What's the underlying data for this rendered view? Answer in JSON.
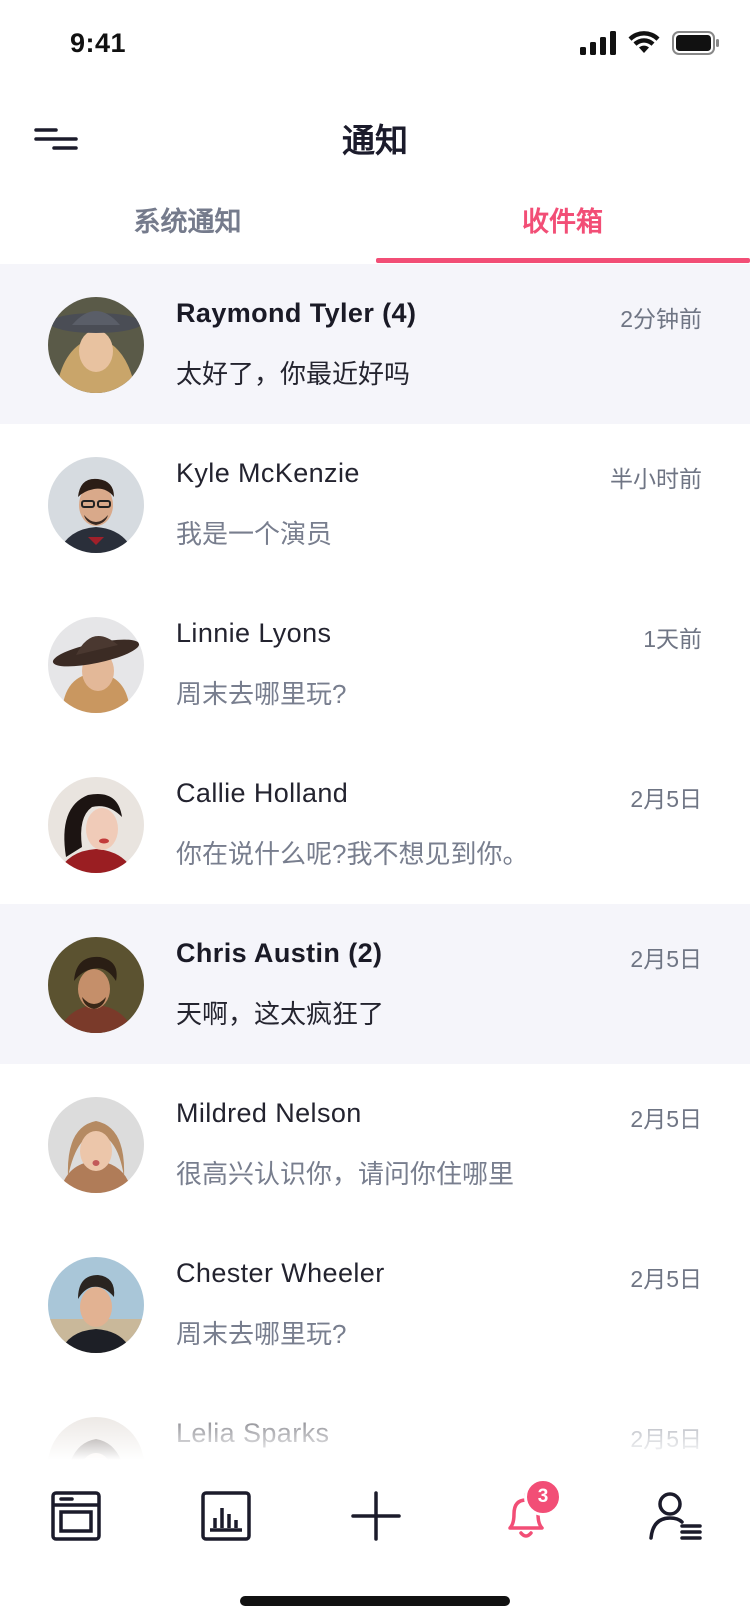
{
  "status_bar": {
    "time": "9:41"
  },
  "header": {
    "title": "通知"
  },
  "tabs": [
    {
      "label": "系统通知",
      "active": false
    },
    {
      "label": "收件箱",
      "active": true
    }
  ],
  "messages": [
    {
      "name": "Raymond Tyler (4)",
      "time": "2分钟前",
      "text": "太好了，你最近好吗",
      "unread": true
    },
    {
      "name": "Kyle McKenzie",
      "time": "半小时前",
      "text": "我是一个演员",
      "unread": false
    },
    {
      "name": "Linnie Lyons",
      "time": "1天前",
      "text": "周末去哪里玩?",
      "unread": false
    },
    {
      "name": "Callie Holland",
      "time": "2月5日",
      "text": "你在说什么呢?我不想见到你。",
      "unread": false
    },
    {
      "name": "Chris Austin (2)",
      "time": "2月5日",
      "text": "天啊，这太疯狂了",
      "unread": true
    },
    {
      "name": "Mildred Nelson",
      "time": "2月5日",
      "text": "很高兴认识你，请问你住哪里",
      "unread": false
    },
    {
      "name": "Chester Wheeler",
      "time": "2月5日",
      "text": "周末去哪里玩?",
      "unread": false
    },
    {
      "name": "Lelia Sparks",
      "time": "2月5日",
      "text": "",
      "unread": false
    }
  ],
  "tab_bar": {
    "items": [
      {
        "icon": "browser-icon",
        "active": false
      },
      {
        "icon": "chart-icon",
        "active": false
      },
      {
        "icon": "plus-icon",
        "active": false
      },
      {
        "icon": "bell-icon",
        "active": true,
        "badge": "3"
      },
      {
        "icon": "profile-icon",
        "active": false
      }
    ]
  },
  "colors": {
    "accent": "#f24e76",
    "unread_bg": "#f5f5fa",
    "muted_text": "#787e8e"
  }
}
